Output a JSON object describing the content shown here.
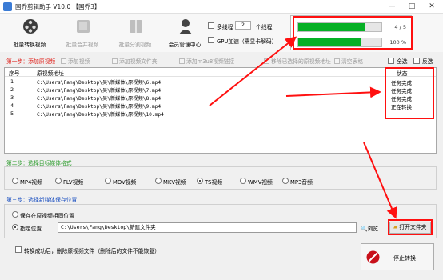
{
  "window": {
    "title": "国乔剪辑助手 V10.0 【国乔3】",
    "minimize": "—",
    "maximize": "□",
    "close": "✕"
  },
  "toolbar": {
    "items": [
      {
        "label": "批量转换视频",
        "icon": "convert-film-icon",
        "enabled": true
      },
      {
        "label": "批量合并视频",
        "icon": "merge-film-icon",
        "enabled": false
      },
      {
        "label": "批量分割视频",
        "icon": "split-film-icon",
        "enabled": false
      },
      {
        "label": "会员管理中心",
        "icon": "member-user-icon",
        "enabled": true
      }
    ]
  },
  "options": {
    "multi_thread_label": "多线程",
    "thread_count": "2",
    "thread_unit": "个线程",
    "gpu_label": "GPU加速（需显卡解码）"
  },
  "progress": {
    "overall": {
      "text": "4 / 5",
      "fraction": 0.8
    },
    "current": {
      "text": "100 %",
      "fraction": 0.76
    },
    "colors": {
      "fill": "#06b025"
    }
  },
  "step1": {
    "title": "第一步：添加原视频",
    "buttons": [
      "添加视频",
      "添加视频文件夹",
      "添加m3u8视频链接",
      "移除已选择的原视频地址",
      "清空表格"
    ],
    "select_all": "全选",
    "invert": "反选"
  },
  "table": {
    "headers": {
      "index": "序号",
      "path": "原视频地址",
      "status": "状态"
    },
    "rows": [
      {
        "index": "1",
        "path": "C:\\Users\\Fang\\Desktop\\吴\\新媒体\\原视频\\6.mp4",
        "status": "任务完成"
      },
      {
        "index": "2",
        "path": "C:\\Users\\Fang\\Desktop\\吴\\新媒体\\原视频\\7.mp4",
        "status": "任务完成"
      },
      {
        "index": "3",
        "path": "C:\\Users\\Fang\\Desktop\\吴\\新媒体\\原视频\\8.mp4",
        "status": "任务完成"
      },
      {
        "index": "4",
        "path": "C:\\Users\\Fang\\Desktop\\吴\\新媒体\\原视频\\9.mp4",
        "status": "正在转换"
      },
      {
        "index": "5",
        "path": "C:\\Users\\Fang\\Desktop\\吴\\新媒体\\原视频\\10.mp4",
        "status": ""
      }
    ]
  },
  "step2": {
    "title": "第二步：选择目标媒体格式",
    "formats": [
      "MP4视频",
      "FLV视频",
      "MOV视频",
      "MKV视频",
      "TS视频",
      "WMV视频",
      "MP3音频"
    ],
    "selected": "TS视频"
  },
  "step3": {
    "title": "第三步：选择新媒体保存位置",
    "same_location": "保存在原视频相同位置",
    "custom_location": "指定位置",
    "path": "C:\\Users\\Fang\\Desktop\\新建文件夹",
    "browse": "浏览",
    "open_folder": "打开文件夹"
  },
  "footer": {
    "delete_option": "转换成功后，删除原视频文件（删除后的文件不能恢复）",
    "stop_button": "停止转换"
  },
  "colors": {
    "step_title": "#e0201a",
    "step2_title": "#2a9a2a",
    "step3_title": "#1a4fc0",
    "annotation_red": "#ff1010",
    "progress_green": "#06b025"
  }
}
